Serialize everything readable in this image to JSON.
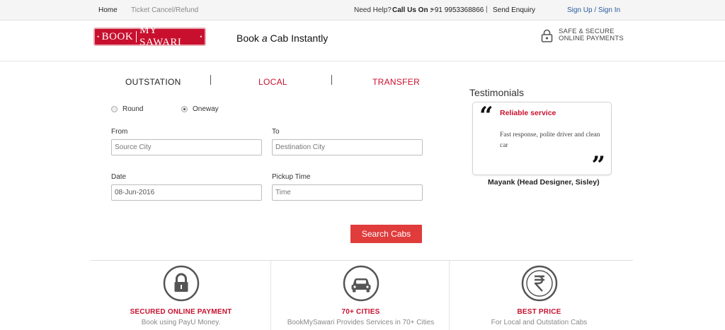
{
  "topbar": {
    "home": "Home",
    "ticket": "Ticket Cancel/Refund",
    "help": "Need Help?",
    "call": "Call Us On :",
    "phone": "+91 9953368866",
    "separator": "|",
    "enquiry": "Send Enquiry",
    "signin": "Sign Up / Sign In"
  },
  "header": {
    "logo_left": "BOOK",
    "logo_right": "MY SAWARI",
    "tagline_a": "Book",
    "tagline_b": "a",
    "tagline_c": "Cab Instantly",
    "secure_line1": "SAFE & SECURE",
    "secure_line2": "ONLINE PAYMENTS"
  },
  "tabs": {
    "outstation": "OUTSTATION",
    "local": "LOCAL",
    "transfer": "TRANSFER"
  },
  "trip_type": {
    "round": "Round",
    "oneway": "Oneway",
    "selected": "Oneway"
  },
  "form": {
    "from_label": "From",
    "from_placeholder": "Source City",
    "to_label": "To",
    "to_placeholder": "Destination City",
    "date_label": "Date",
    "date_value": "08-Jun-2016",
    "time_label": "Pickup Time",
    "time_placeholder": "Time",
    "search_label": "Search Cabs"
  },
  "testimonials": {
    "title": "Testimonials",
    "heading": "Reliable service",
    "text": "Fast response, polite driver and clean car",
    "author": "Mayank (Head Designer, Sisley)"
  },
  "features": [
    {
      "icon": "lock-icon",
      "title": "SECURED ONLINE PAYMENT",
      "subtitle": "Book using PayU Money."
    },
    {
      "icon": "car-icon",
      "title": "70+ CITIES",
      "subtitle": "BookMySawari Provides Services in 70+ Cities"
    },
    {
      "icon": "rupee-icon",
      "title": "BEST PRICE",
      "subtitle": "For Local and Outstation Cabs"
    }
  ],
  "colors": {
    "brand_red": "#c8102e",
    "button_red": "#e03c3c",
    "link_blue": "#2a5a9c",
    "icon_gray": "#555555"
  }
}
